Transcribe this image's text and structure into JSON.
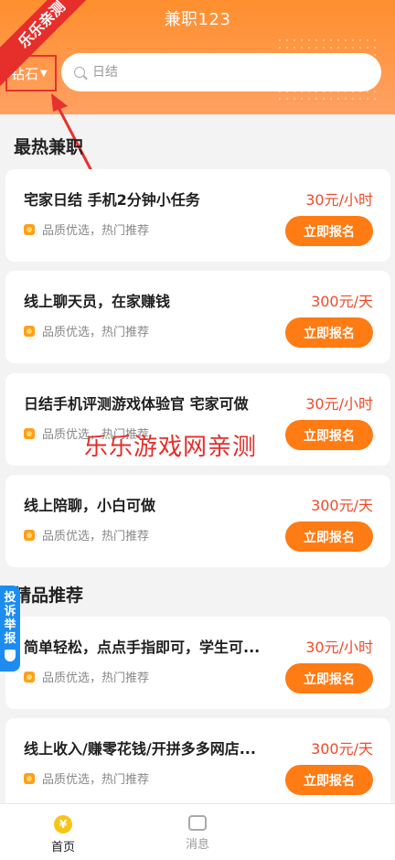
{
  "app": {
    "title": "兼职123"
  },
  "header": {
    "city": "钻石",
    "search_placeholder": "日结"
  },
  "overlay": {
    "ribbon": "乐乐亲测",
    "watermark": "乐乐游戏网亲测",
    "report": "投诉举报"
  },
  "sections": [
    {
      "title": "最热兼职"
    },
    {
      "title": "精品推荐"
    }
  ],
  "jobs": [
    {
      "title": "宅家日结 手机2分钟小任务",
      "salary": "30元/小时",
      "tag": "品质优选，热门推荐",
      "button": "立即报名"
    },
    {
      "title": "线上聊天员，在家赚钱",
      "salary": "300元/天",
      "tag": "品质优选，热门推荐",
      "button": "立即报名"
    },
    {
      "title": "日结手机评测游戏体验官 宅家可做",
      "salary": "30元/小时",
      "tag": "品质优选，热门推荐",
      "button": "立即报名"
    },
    {
      "title": "线上陪聊，小白可做",
      "salary": "300元/天",
      "tag": "品质优选，热门推荐",
      "button": "立即报名"
    },
    {
      "title": "简单轻松，点点手指即可，学生可...",
      "salary": "30元/小时",
      "tag": "品质优选，热门推荐",
      "button": "立即报名"
    },
    {
      "title": "线上收入/赚零花钱/开拼多多网店...",
      "salary": "300元/天",
      "tag": "品质优选，热门推荐",
      "button": "立即报名"
    }
  ],
  "tabbar": [
    {
      "label": "首页",
      "icon": "yen-coin-icon",
      "active": true
    },
    {
      "label": "消息",
      "icon": "message-icon",
      "active": false
    }
  ],
  "colors": {
    "accent": "#ff7b14",
    "salary": "#f04a28",
    "header_start": "#ff8f2e",
    "highlight_red": "#e62e2b"
  }
}
